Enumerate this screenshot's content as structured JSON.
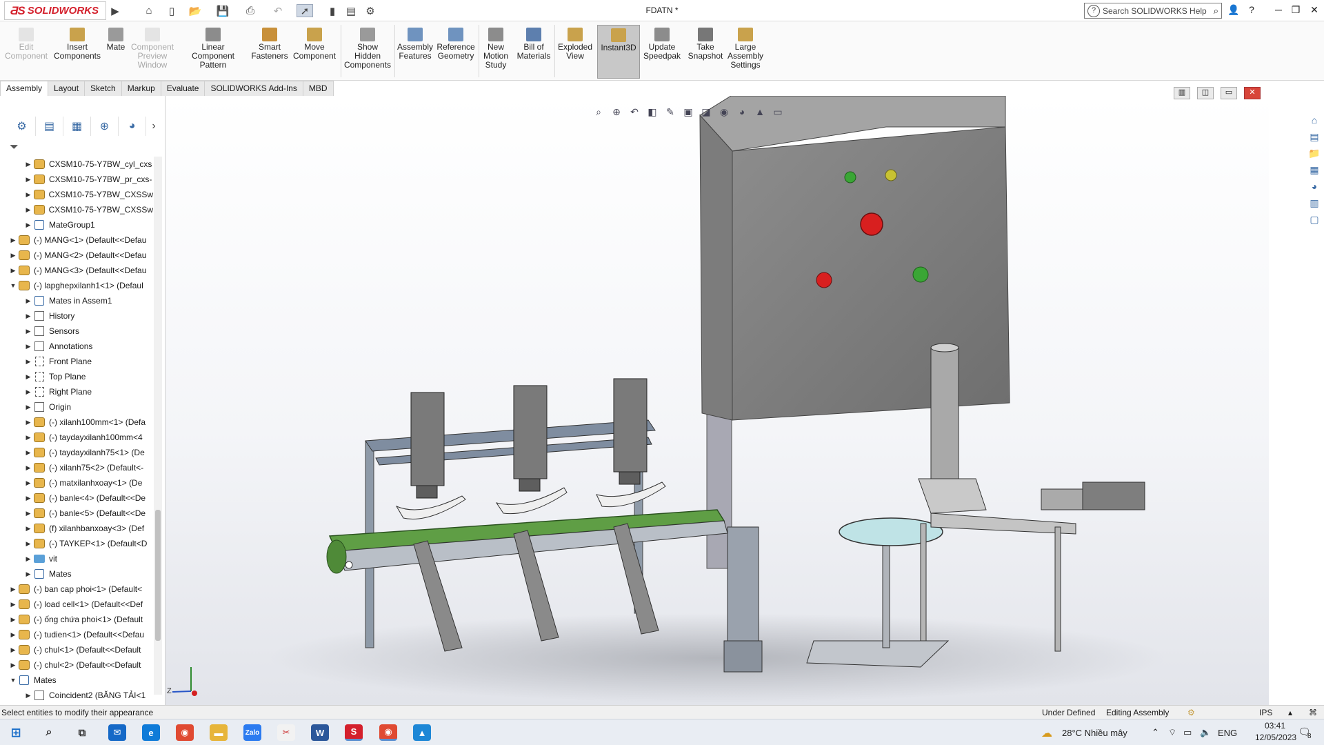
{
  "app": {
    "logo_text": "SOLIDWORKS",
    "document_title": "FDATN *",
    "search_placeholder": "Search SOLIDWORKS Help"
  },
  "ribbon": {
    "buttons": [
      {
        "label": "Edit\nComponent",
        "enabled": false,
        "icon": "edit-component-icon"
      },
      {
        "label": "Insert\nComponents",
        "enabled": true,
        "icon": "insert-components-icon"
      },
      {
        "label": "Mate",
        "enabled": true,
        "icon": "mate-icon"
      },
      {
        "label": "Component\nPreview\nWindow",
        "enabled": false,
        "icon": "preview-window-icon"
      },
      {
        "label": "Linear Component\nPattern",
        "enabled": true,
        "icon": "linear-pattern-icon"
      },
      {
        "label": "Smart\nFasteners",
        "enabled": true,
        "icon": "smart-fasteners-icon"
      },
      {
        "label": "Move\nComponent",
        "enabled": true,
        "icon": "move-component-icon"
      },
      {
        "label": "Show\nHidden\nComponents",
        "enabled": true,
        "icon": "show-hidden-icon"
      },
      {
        "label": "Assembly\nFeatures",
        "enabled": true,
        "icon": "assembly-features-icon"
      },
      {
        "label": "Reference\nGeometry",
        "enabled": true,
        "icon": "reference-geometry-icon"
      },
      {
        "label": "New\nMotion\nStudy",
        "enabled": true,
        "icon": "motion-study-icon"
      },
      {
        "label": "Bill of\nMaterials",
        "enabled": true,
        "icon": "bom-icon"
      },
      {
        "label": "Exploded\nView",
        "enabled": true,
        "icon": "exploded-view-icon"
      },
      {
        "label": "Instant3D",
        "enabled": true,
        "active": true,
        "icon": "instant3d-icon"
      },
      {
        "label": "Update\nSpeedpak",
        "enabled": true,
        "icon": "speedpak-icon"
      },
      {
        "label": "Take\nSnapshot",
        "enabled": true,
        "icon": "snapshot-icon"
      },
      {
        "label": "Large\nAssembly\nSettings",
        "enabled": true,
        "icon": "large-assembly-icon"
      }
    ]
  },
  "tabs": [
    "Assembly",
    "Layout",
    "Sketch",
    "Markup",
    "Evaluate",
    "SOLIDWORKS Add-Ins",
    "MBD"
  ],
  "active_tab": "Assembly",
  "tree": [
    {
      "label": "CXSM10-75-Y7BW_cyl_cxs",
      "icon": "assembly",
      "indent": 2
    },
    {
      "label": "CXSM10-75-Y7BW_pr_cxs-",
      "icon": "assembly",
      "indent": 2
    },
    {
      "label": "CXSM10-75-Y7BW_CXSSw",
      "icon": "assembly",
      "indent": 2
    },
    {
      "label": "CXSM10-75-Y7BW_CXSSw",
      "icon": "assembly",
      "indent": 2
    },
    {
      "label": "MateGroup1",
      "icon": "mate",
      "indent": 2
    },
    {
      "label": "(-) MANG<1> (Default<<Defau",
      "icon": "assembly",
      "indent": 1
    },
    {
      "label": "(-) MANG<2> (Default<<Defau",
      "icon": "assembly",
      "indent": 1
    },
    {
      "label": "(-) MANG<3> (Default<<Defau",
      "icon": "assembly",
      "indent": 1
    },
    {
      "label": "(-) lapghepxilanh1<1> (Defaul",
      "icon": "assembly",
      "indent": 1,
      "expanded": true
    },
    {
      "label": "Mates in Assem1",
      "icon": "mate",
      "indent": 2
    },
    {
      "label": "History",
      "icon": "gen",
      "indent": 2
    },
    {
      "label": "Sensors",
      "icon": "gen",
      "indent": 2
    },
    {
      "label": "Annotations",
      "icon": "gen",
      "indent": 2
    },
    {
      "label": "Front Plane",
      "icon": "plane",
      "indent": 2
    },
    {
      "label": "Top Plane",
      "icon": "plane",
      "indent": 2
    },
    {
      "label": "Right Plane",
      "icon": "plane",
      "indent": 2
    },
    {
      "label": "Origin",
      "icon": "gen",
      "indent": 2
    },
    {
      "label": "(-) xilanh100mm<1> (Defa",
      "icon": "assembly",
      "indent": 2
    },
    {
      "label": "(-) taydayxilanh100mm<4",
      "icon": "assembly",
      "indent": 2
    },
    {
      "label": "(-) taydayxilanh75<1> (De",
      "icon": "assembly",
      "indent": 2
    },
    {
      "label": "(-) xilanh75<2> (Default<-",
      "icon": "assembly",
      "indent": 2
    },
    {
      "label": "(-) matxilanhxoay<1> (De",
      "icon": "assembly",
      "indent": 2
    },
    {
      "label": "(-) banle<4> (Default<<De",
      "icon": "assembly",
      "indent": 2
    },
    {
      "label": "(-) banle<5> (Default<<De",
      "icon": "assembly",
      "indent": 2
    },
    {
      "label": "(f) xilanhbanxoay<3> (Def",
      "icon": "assembly",
      "indent": 2
    },
    {
      "label": "(-) TAYKEP<1> (Default<D",
      "icon": "assembly",
      "indent": 2
    },
    {
      "label": "vit",
      "icon": "folder",
      "indent": 2
    },
    {
      "label": "Mates",
      "icon": "mate",
      "indent": 2
    },
    {
      "label": "(-) ban cap phoi<1> (Default<",
      "icon": "assembly",
      "indent": 1
    },
    {
      "label": "(-) load cell<1> (Default<<Def",
      "icon": "assembly",
      "indent": 1
    },
    {
      "label": "(-) ống chứa phoi<1> (Default",
      "icon": "assembly",
      "indent": 1
    },
    {
      "label": "(-) tudien<1> (Default<<Defau",
      "icon": "assembly",
      "indent": 1
    },
    {
      "label": "(-) chul<1> (Default<<Default",
      "icon": "assembly",
      "indent": 1
    },
    {
      "label": "(-) chul<2> (Default<<Default",
      "icon": "assembly",
      "indent": 1
    },
    {
      "label": "Mates",
      "icon": "mate",
      "indent": 1,
      "expanded": true
    },
    {
      "label": "Coincident2 (BĂNG TẢI<1",
      "icon": "gen",
      "indent": 2
    }
  ],
  "status": {
    "message": "Select entities to modify their appearance",
    "definition": "Under Defined",
    "mode": "Editing Assembly",
    "units": "IPS"
  },
  "taskbar": {
    "weather": "28°C  Nhiều mây",
    "language": "ENG",
    "time": "03:41",
    "date": "12/05/2023",
    "notifications": "8"
  },
  "colors": {
    "brand": "#d4202c",
    "conveyor_belt": "#5f9e45",
    "button_red": "#d81f1f",
    "button_green": "#3aa635",
    "button_yellow": "#c8c232"
  }
}
